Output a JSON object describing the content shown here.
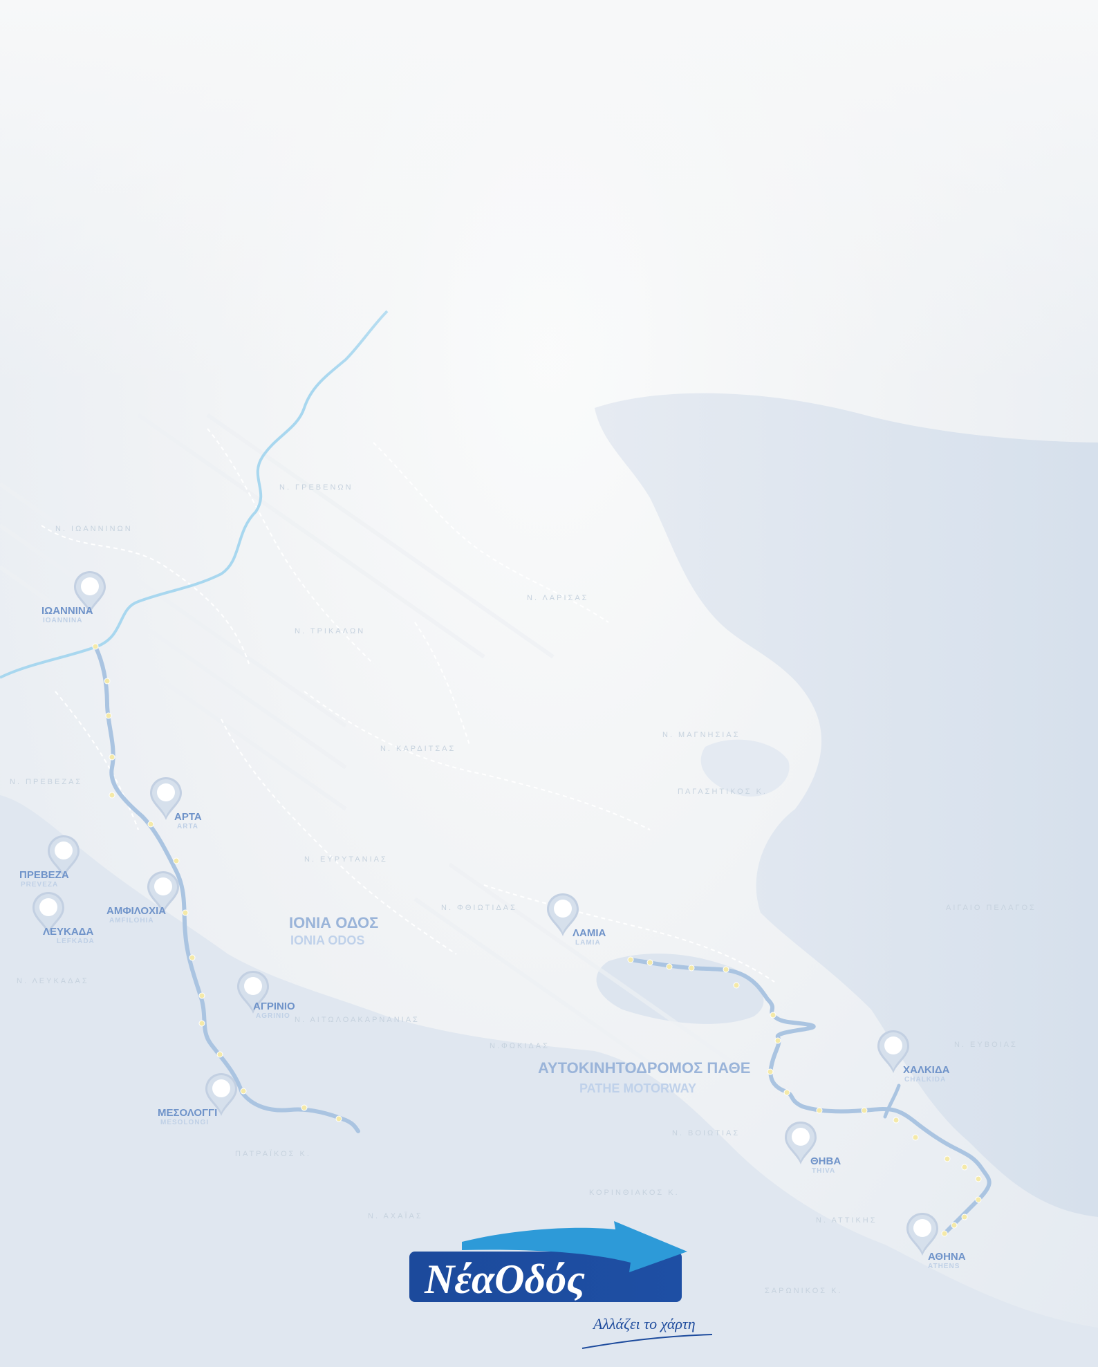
{
  "motorways": {
    "ionia": {
      "name": "ΙΟΝΙΑ ΟΔΟΣ",
      "name_latin": "IONIA ODOS"
    },
    "pathe": {
      "name": "ΑΥΤΟΚΙΝΗΤΟΔΡΟΜΟΣ ΠΑΘΕ",
      "name_latin": "PATHE MOTORWAY"
    }
  },
  "cities": {
    "ioannina": {
      "name": "ΙΩΑΝΝΙΝΑ",
      "latin": "IOANNINA"
    },
    "arta": {
      "name": "ΑΡΤΑ",
      "latin": "ARTA"
    },
    "preveza": {
      "name": "ΠΡΕΒΕΖΑ",
      "latin": "PREVEZA"
    },
    "amfilochia": {
      "name": "ΑΜΦΙΛΟΧΙΑ",
      "latin": "AMFILOHIA"
    },
    "lefkada": {
      "name": "ΛΕΥΚΑΔΑ",
      "latin": "LEFKADA"
    },
    "agrinio": {
      "name": "ΑΓΡΙΝΙΟ",
      "latin": "AGRINIO"
    },
    "mesolongi": {
      "name": "ΜΕΣΟΛΟΓΓΙ",
      "latin": "MESOLONGI"
    },
    "lamia": {
      "name": "ΛΑΜΙΑ",
      "latin": "LAMIA"
    },
    "chalkida": {
      "name": "ΧΑΛΚΙΔΑ",
      "latin": "CHALKIDA"
    },
    "thiva": {
      "name": "ΘΗΒΑ",
      "latin": "THIVA"
    },
    "athina": {
      "name": "ΑΘΗΝΑ",
      "latin": "ATHENS"
    }
  },
  "prefectures": {
    "ioanninon": "Ν. ΙΩΑΝΝΙΝΩΝ",
    "grevenon": "Ν. ΓΡΕΒΕΝΩΝ",
    "trikalon": "Ν. ΤΡΙΚΑΛΩΝ",
    "larisas": "Ν. ΛΑΡΙΣΑΣ",
    "karditsas": "Ν. ΚΑΡΔΙΤΣΑΣ",
    "magnisias": "Ν. ΜΑΓΝΗΣΙΑΣ",
    "prevezas": "Ν. ΠΡΕΒΕΖΑΣ",
    "pagasitikos": "ΠΑΓΑΣΗΤΙΚΟΣ Κ.",
    "evrytanias": "Ν. ΕΥΡΥΤΑΝΙΑΣ",
    "fthiotidas": "Ν. ΦΘΙΩΤΙΔΑΣ",
    "aigaio": "ΑΙΓΑΙΟ ΠΕΛΑΓΟΣ",
    "lefkadas": "Ν. ΛΕΥΚΑΔΑΣ",
    "aitoloakarnanias": "Ν. ΑΙΤΩΛΟΑΚΑΡΝΑΝΙΑΣ",
    "fokidas": "Ν.ΦΩΚΙΔΑΣ",
    "evoias": "Ν. ΕΥΒΟΙΑΣ",
    "viotias": "Ν. ΒΟΙΩΤΙΑΣ",
    "patraikos": "ΠΑΤΡΑΪΚΟΣ Κ.",
    "korinthiakos": "ΚΟΡΙΝΘΙΑΚΟΣ Κ.",
    "achaias": "Ν. ΑΧΑΪΑΣ",
    "attikis": "Ν. ΑΤΤΙΚΗΣ",
    "saronikos": "ΣΑΡΩΝΙΚΟΣ Κ."
  },
  "logo": {
    "part1": "Νέα",
    "part2": "Οδός",
    "slogan": "Αλλάζει το χάρτη"
  },
  "colors": {
    "accent_blue": "#1c4a9c",
    "logo_arrow": "#2d9ad8",
    "road": "#aac4e1",
    "river": "#a8d7ef",
    "sea": "#dde5ef",
    "land": "#f3f5f7"
  }
}
